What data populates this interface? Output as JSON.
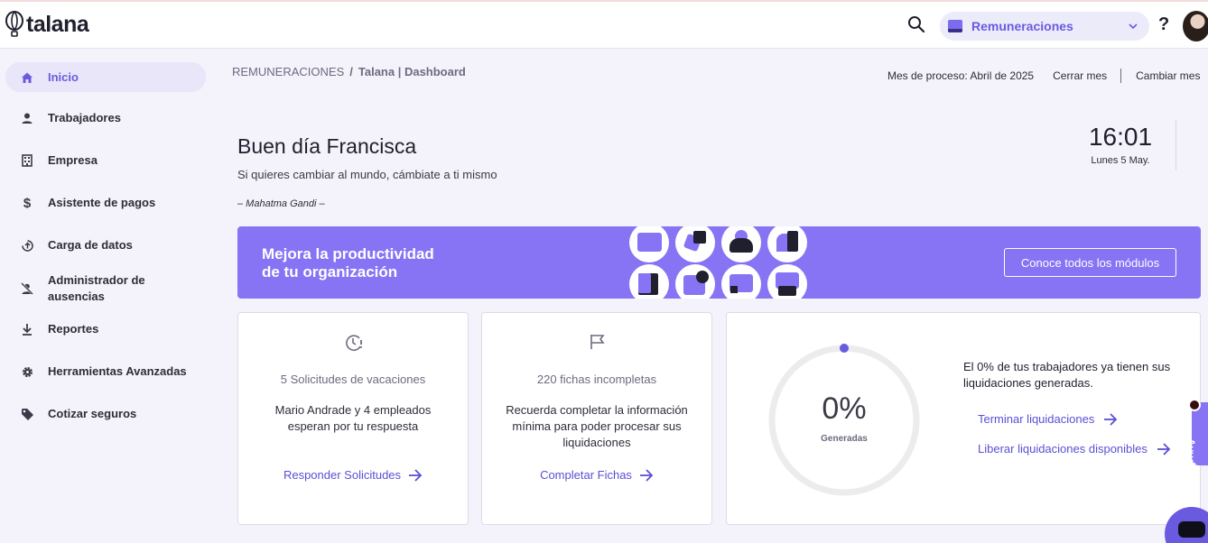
{
  "header": {
    "logo_text": "talana",
    "module_selector": "Remuneraciones",
    "help_label": "?"
  },
  "sidebar": {
    "items": [
      {
        "label": "Inicio",
        "icon": "home-icon",
        "active": true
      },
      {
        "label": "Trabajadores",
        "icon": "person-icon"
      },
      {
        "label": "Empresa",
        "icon": "building-icon"
      },
      {
        "label": "Asistente de pagos",
        "icon": "dollar-icon"
      },
      {
        "label": "Carga de datos",
        "icon": "upload-icon"
      },
      {
        "label": "Administrador de ausencias",
        "icon": "person-off-icon"
      },
      {
        "label": "Reportes",
        "icon": "download-icon"
      },
      {
        "label": "Herramientas Avanzadas",
        "icon": "gear-icon"
      },
      {
        "label": "Cotizar seguros",
        "icon": "tag-icon"
      }
    ]
  },
  "breadcrumb": {
    "root": "REMUNERACIONES",
    "separator": "/",
    "current": "Talana | Dashboard"
  },
  "process": {
    "label": "Mes de proceso: Abril de 2025",
    "close_month": "Cerrar mes",
    "change_month": "Cambiar mes"
  },
  "greeting": {
    "title": "Buen día Francisca",
    "quote": "Si quieres cambiar al mundo, cámbiate a ti mismo",
    "author": "– Mahatma Gandi –"
  },
  "clock": {
    "time": "16:01",
    "date": "Lunes 5 May."
  },
  "banner": {
    "title_line1": "Mejora la productividad",
    "title_line2": "de tu organización",
    "button": "Conoce todos los módulos"
  },
  "cards": [
    {
      "icon": "clock-alert-icon",
      "title": "5 Solicitudes de vacaciones",
      "text": "Mario Andrade y 4 empleados esperan por tu respuesta",
      "link": "Responder Solicitudes"
    },
    {
      "icon": "flag-icon",
      "title": "220 fichas incompletas",
      "text": "Recuerda completar la información mínima para poder procesar sus liquidaciones",
      "link": "Completar Fichas"
    }
  ],
  "liquidaciones": {
    "percent": 0,
    "value_text": "0%",
    "label": "Generadas",
    "description": "El 0% de tus trabajadores ya tienen sus liquidaciones generadas.",
    "link_finish": "Terminar liquidaciones",
    "link_release": "Liberar liquidaciones disponibles"
  },
  "help_tab": "Ayuda",
  "colors": {
    "accent": "#6a5ae0",
    "banner": "#8674f4",
    "background": "#f4f3fb"
  }
}
